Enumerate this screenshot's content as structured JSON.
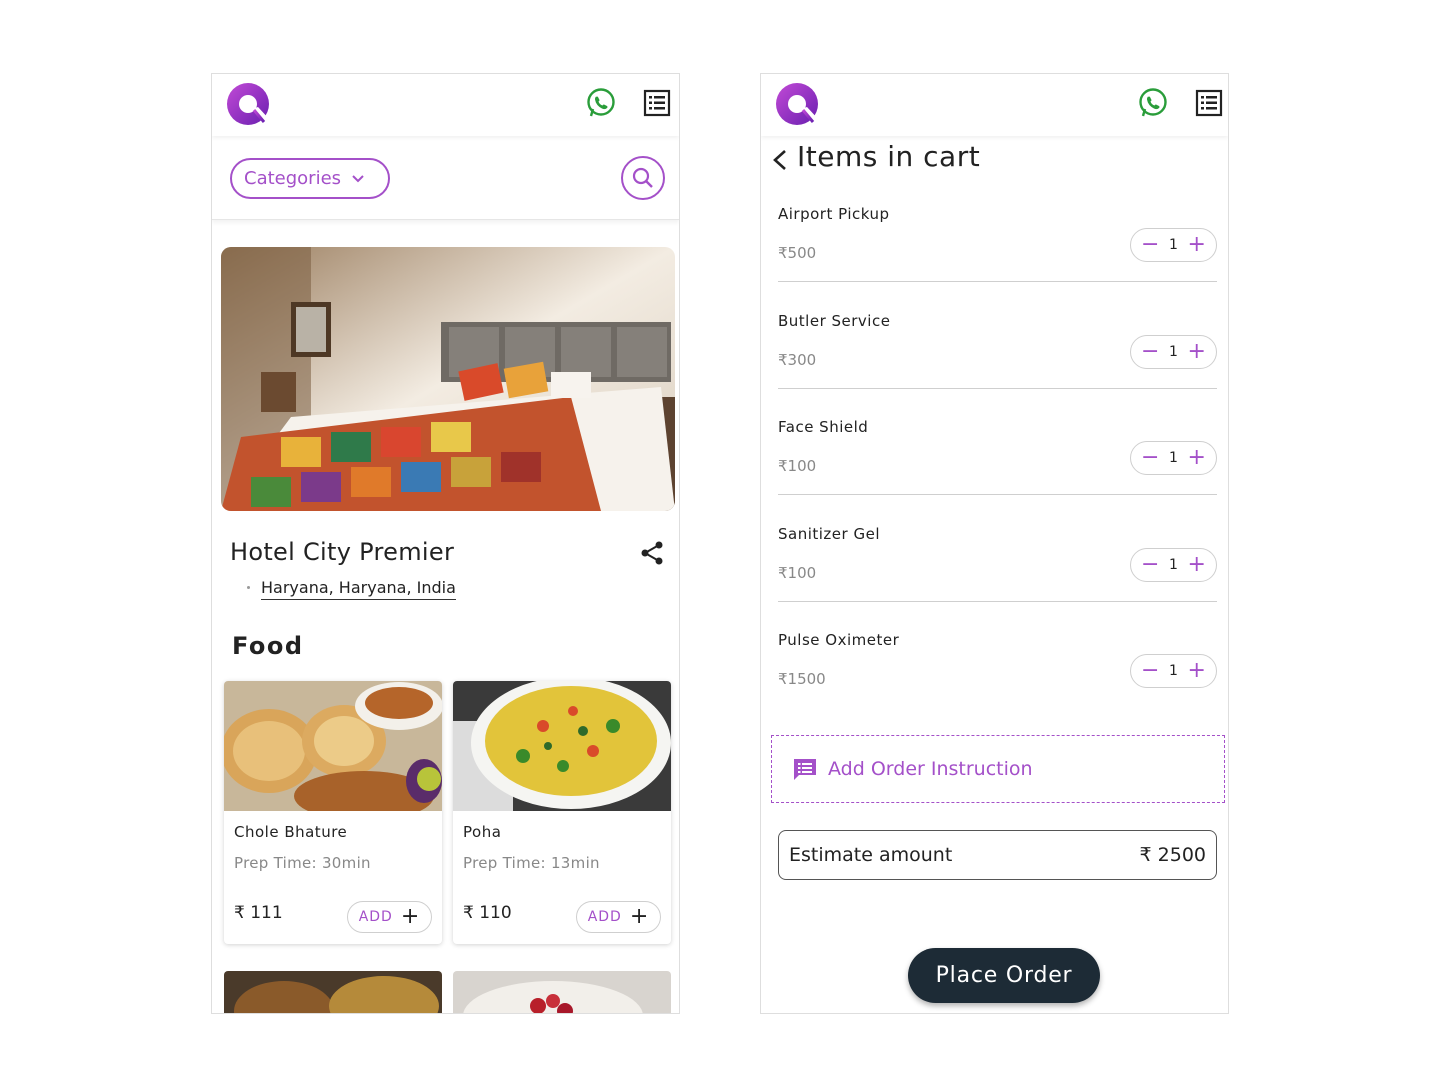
{
  "colors": {
    "brand": "#a450c9",
    "whatsapp": "#2a9d3a",
    "dark_button": "#1d2b36"
  },
  "left_screen": {
    "header": {
      "logo_icon": "q-logo-icon",
      "whatsapp_icon": "whatsapp-icon",
      "menu_icon": "list-menu-icon"
    },
    "categories_label": "Categories",
    "hotel": {
      "name": "Hotel City Premier",
      "location": "Haryana, Haryana, India"
    },
    "section_title": "Food",
    "food_items": [
      {
        "name": "Chole Bhature",
        "prep": "Prep Time: 30min",
        "price": "₹ 111",
        "add_label": "ADD"
      },
      {
        "name": "Poha",
        "prep": "Prep Time: 13min",
        "price": "₹ 110",
        "add_label": "ADD"
      }
    ]
  },
  "right_screen": {
    "title": "Items in cart",
    "cart_items": [
      {
        "name": "Airport Pickup",
        "price": "₹500",
        "qty": "1"
      },
      {
        "name": "Butler Service",
        "price": "₹300",
        "qty": "1"
      },
      {
        "name": "Face Shield",
        "price": "₹100",
        "qty": "1"
      },
      {
        "name": "Sanitizer Gel",
        "price": "₹100",
        "qty": "1"
      },
      {
        "name": "Pulse Oximeter",
        "price": "₹1500",
        "qty": "1"
      }
    ],
    "instruction_label": "Add Order Instruction",
    "estimate_label": "Estimate amount",
    "estimate_value": "₹ 2500",
    "place_order_label": "Place Order"
  }
}
